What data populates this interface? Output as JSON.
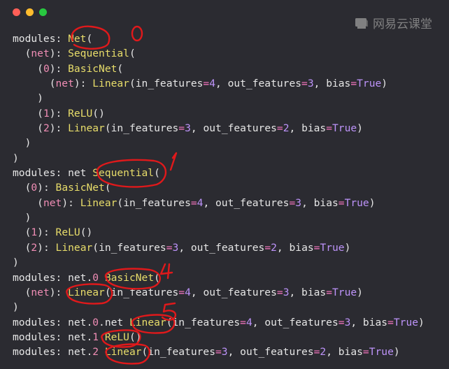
{
  "window": {
    "controls": [
      {
        "name": "close",
        "color": "#ff5f57"
      },
      {
        "name": "minimize",
        "color": "#febc2e"
      },
      {
        "name": "zoom",
        "color": "#28c840"
      }
    ]
  },
  "watermark": {
    "text": "网易云课堂",
    "icon": "netease-cloud-classroom-logo"
  },
  "code_lines": [
    "modules: Net(",
    "  (net): Sequential(",
    "    (0): BasicNet(",
    "      (net): Linear(in_features=4, out_features=3, bias=True)",
    "    )",
    "    (1): ReLU()",
    "    (2): Linear(in_features=3, out_features=2, bias=True)",
    "  )",
    ")",
    "modules: net Sequential(",
    "  (0): BasicNet(",
    "    (net): Linear(in_features=4, out_features=3, bias=True)",
    "  )",
    "  (1): ReLU()",
    "  (2): Linear(in_features=3, out_features=2, bias=True)",
    ")",
    "modules: net.0 BasicNet(",
    "  (net): Linear(in_features=4, out_features=3, bias=True)",
    ")",
    "modules: net.0.net Linear(in_features=4, out_features=3, bias=True)",
    "modules: net.1 ReLU()",
    "modules: net.2 Linear(in_features=3, out_features=2, bias=True)"
  ],
  "handwritten_labels": [
    "0",
    "1",
    "4",
    "5"
  ],
  "colors": {
    "background": "#2b2b31",
    "text": "#e6e6e6",
    "class_name": "#e8dd6a",
    "index": "#f08db5",
    "param_value": "#bd93f9",
    "operator": "#ff79c6",
    "annotation": "#e0191b"
  }
}
